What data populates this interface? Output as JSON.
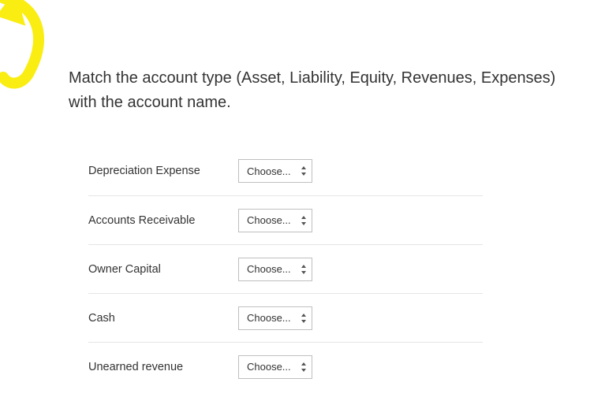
{
  "question": {
    "text": "Match the account type  (Asset, Liability, Equity, Revenues, Expenses) with the account name."
  },
  "dropdown": {
    "placeholder": "Choose..."
  },
  "items": [
    {
      "label": "Depreciation Expense"
    },
    {
      "label": "Accounts Receivable"
    },
    {
      "label": "Owner Capital"
    },
    {
      "label": "Cash"
    },
    {
      "label": "Unearned revenue"
    }
  ],
  "annotation": {
    "color": "#f9ed12"
  }
}
